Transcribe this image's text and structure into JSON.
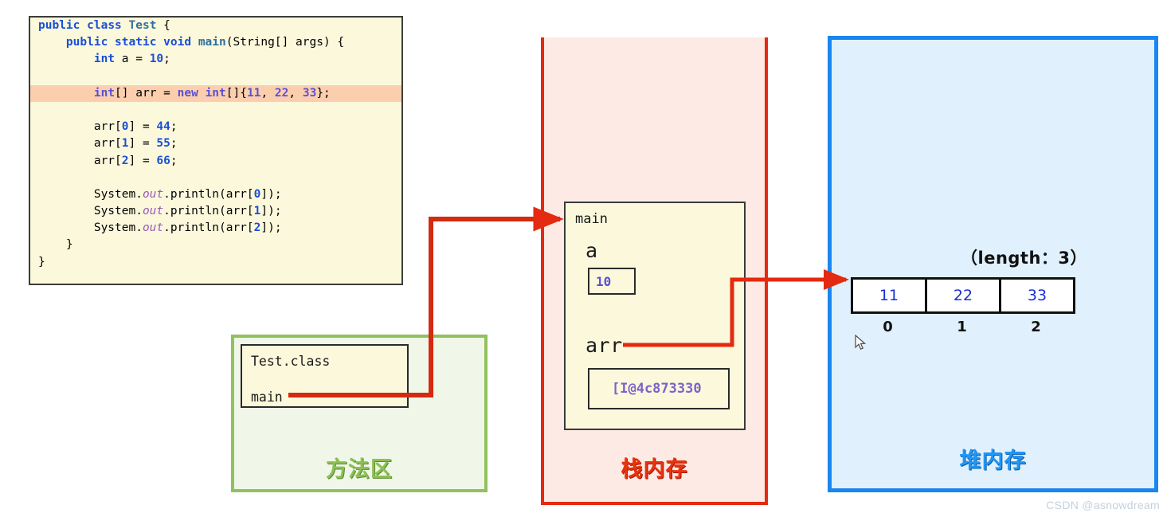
{
  "code_panel": {
    "lines": [
      {
        "id": "l1",
        "text": "public class Test {",
        "highlight": false
      },
      {
        "id": "l2",
        "text": "    public static void main(String[] args) {",
        "highlight": false
      },
      {
        "id": "l3",
        "text": "        int a = 10;",
        "highlight": false
      },
      {
        "id": "l4",
        "text": "",
        "highlight": false
      },
      {
        "id": "l5",
        "text": "        int[] arr = new int[]{11, 22, 33};",
        "highlight": true
      },
      {
        "id": "l6",
        "text": "",
        "highlight": false
      },
      {
        "id": "l7",
        "text": "        arr[0] = 44;",
        "highlight": false
      },
      {
        "id": "l8",
        "text": "        arr[1] = 55;",
        "highlight": false
      },
      {
        "id": "l9",
        "text": "        arr[2] = 66;",
        "highlight": false
      },
      {
        "id": "l10",
        "text": "",
        "highlight": false
      },
      {
        "id": "l11",
        "text": "        System.out.println(arr[0]);",
        "highlight": false
      },
      {
        "id": "l12",
        "text": "        System.out.println(arr[1]);",
        "highlight": false
      },
      {
        "id": "l13",
        "text": "        System.out.println(arr[2]);",
        "highlight": false
      },
      {
        "id": "l14",
        "text": "    }",
        "highlight": false
      },
      {
        "id": "l15",
        "text": "}",
        "highlight": false
      }
    ]
  },
  "method_area": {
    "label": "方法区",
    "class_box": {
      "class_name": "Test.class",
      "method_name": "main"
    },
    "border_color": "#90c25b",
    "fill_color": "#f0f7e9"
  },
  "stack_area": {
    "label": "栈内存",
    "frame": {
      "title": "main",
      "variables": [
        {
          "name": "a",
          "value": "10"
        },
        {
          "name": "arr",
          "value": "[I@4c873330"
        }
      ]
    },
    "border_color": "#e42a10",
    "fill_color": "#fdeae4"
  },
  "heap_area": {
    "label": "堆内存",
    "length_label": "（length：3）",
    "array": {
      "values": [
        "11",
        "22",
        "33"
      ],
      "indices": [
        "0",
        "1",
        "2"
      ]
    },
    "border_color": "#1b86f0",
    "fill_color": "#e0f0fc"
  },
  "arrows": {
    "method_to_stack": "main-reference-arrow",
    "stack_to_heap": "arr-reference-arrow",
    "color": "#e42a10"
  },
  "cursor": {
    "icon": "mouse-pointer"
  },
  "watermark": {
    "text": "CSDN @asnowdream"
  }
}
